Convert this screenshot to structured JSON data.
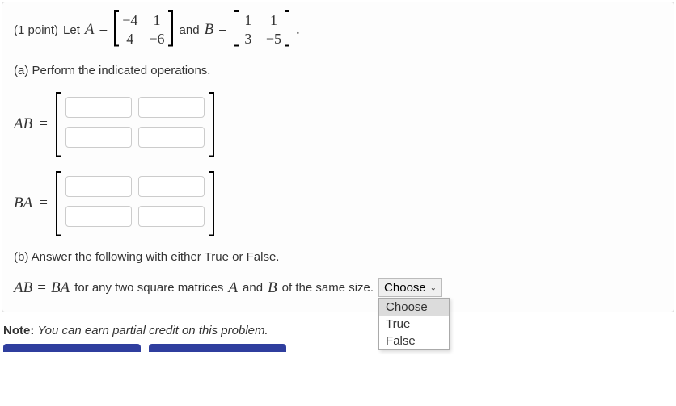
{
  "points_label": "(1 point)",
  "let_text": "Let",
  "and_text": "and",
  "var_A": "A",
  "var_B": "B",
  "eq_sym": "=",
  "dot_sym": ".",
  "matrix_A": {
    "r0c0": "−4",
    "r0c1": "1",
    "r1c0": "4",
    "r1c1": "−6"
  },
  "matrix_B": {
    "r0c0": "1",
    "r0c1": "1",
    "r1c0": "3",
    "r1c1": "−5"
  },
  "part_a": "(a) Perform the indicated operations.",
  "label_AB": "AB",
  "label_BA": "BA",
  "part_b": "(b) Answer the following with either True or False.",
  "stmt": {
    "lhs": "AB",
    "eq": "=",
    "rhs": "BA",
    "tail": "for any two square matrices",
    "mid_A": "A",
    "and": "and",
    "mid_B": "B",
    "tail2": "of the same size."
  },
  "select": {
    "placeholder": "Choose",
    "options": {
      "o0": "Choose",
      "o1": "True",
      "o2": "False"
    }
  },
  "note": {
    "bold": "Note:",
    "rest": "You can earn partial credit on this problem."
  }
}
